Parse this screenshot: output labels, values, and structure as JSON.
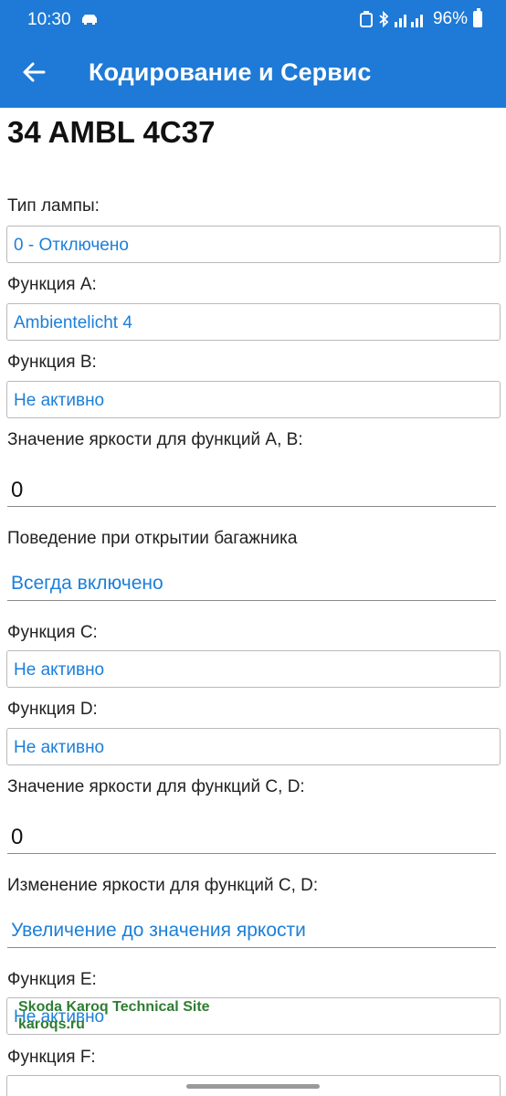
{
  "status_bar": {
    "time": "10:30",
    "battery": "96%"
  },
  "app_bar": {
    "title": "Кодирование и Сервис"
  },
  "module_code": "34 AMBL 4C37",
  "fields": {
    "lamp_type": {
      "label": "Тип лампы:",
      "value": "0 - Отключено"
    },
    "function_a": {
      "label": "Функция А:",
      "value": "Ambientelicht 4"
    },
    "function_b": {
      "label": "Функция B:",
      "value": "Не активно"
    },
    "brightness_ab": {
      "label": "Значение яркости для функций A, B:",
      "value": "0"
    },
    "trunk_behavior": {
      "label": "Поведение при открытии багажника",
      "value": "Всегда включено"
    },
    "function_c": {
      "label": "Функция C:",
      "value": "Не активно"
    },
    "function_d": {
      "label": "Функция D:",
      "value": "Не активно"
    },
    "brightness_cd": {
      "label": "Значение яркости для функций C, D:",
      "value": "0"
    },
    "brightness_change_cd": {
      "label": "Изменение яркости для функций C, D:",
      "value": "Увеличение до значения яркости"
    },
    "function_e": {
      "label": "Функция E:",
      "value": "Не активно"
    },
    "function_f": {
      "label": "Функция F:",
      "value": ""
    }
  },
  "watermark": {
    "line1": "Skoda Karoq Technical Site",
    "line2": "karoqs.ru"
  }
}
